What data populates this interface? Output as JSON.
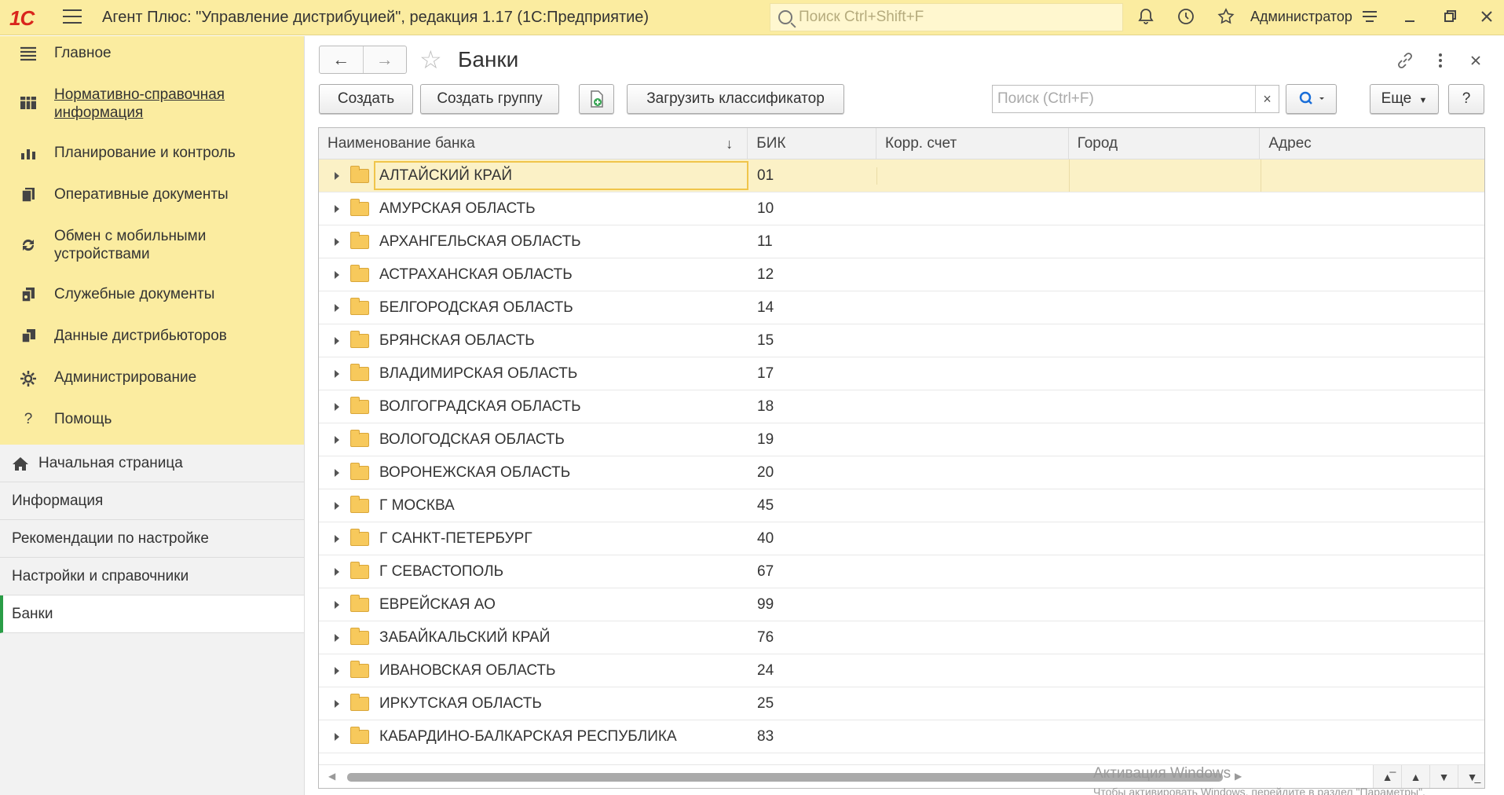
{
  "app": {
    "logo": "1С",
    "title": "Агент Плюс: \"Управление дистрибуцией\", редакция 1.17  (1С:Предприятие)",
    "search_placeholder": "Поиск Ctrl+Shift+F",
    "user": "Администратор"
  },
  "sidebar": {
    "sections": [
      {
        "label": "Главное",
        "icon": "menu-list-icon"
      },
      {
        "label": "Нормативно-справочная информация",
        "icon": "reference-table-icon"
      },
      {
        "label": "Планирование и контроль",
        "icon": "bar-chart-icon"
      },
      {
        "label": "Оперативные документы",
        "icon": "documents-icon"
      },
      {
        "label": "Обмен с мобильными устройствами",
        "icon": "sync-icon"
      },
      {
        "label": "Служебные документы",
        "icon": "service-docs-icon"
      },
      {
        "label": "Данные дистрибьюторов",
        "icon": "distributor-data-icon"
      },
      {
        "label": "Администрирование",
        "icon": "gear-icon"
      },
      {
        "label": "Помощь",
        "icon": "help-icon"
      }
    ],
    "open_pages": [
      {
        "label": "Начальная страница"
      },
      {
        "label": "Информация"
      },
      {
        "label": "Рекомендации по настройке"
      },
      {
        "label": "Настройки и справочники"
      },
      {
        "label": "Банки"
      }
    ]
  },
  "form": {
    "title": "Банки",
    "toolbar": {
      "create": "Создать",
      "create_group": "Создать группу",
      "load_classifier": "Загрузить классификатор",
      "search_placeholder": "Поиск (Ctrl+F)",
      "more": "Еще",
      "help": "?"
    },
    "columns": [
      "Наименование банка",
      "БИК",
      "Корр. счет",
      "Город",
      "Адрес"
    ],
    "rows": [
      {
        "name": "АЛТАЙСКИЙ КРАЙ",
        "bik": "01"
      },
      {
        "name": "АМУРСКАЯ ОБЛАСТЬ",
        "bik": "10"
      },
      {
        "name": "АРХАНГЕЛЬСКАЯ ОБЛАСТЬ",
        "bik": "11"
      },
      {
        "name": "АСТРАХАНСКАЯ ОБЛАСТЬ",
        "bik": "12"
      },
      {
        "name": "БЕЛГОРОДСКАЯ ОБЛАСТЬ",
        "bik": "14"
      },
      {
        "name": "БРЯНСКАЯ ОБЛАСТЬ",
        "bik": "15"
      },
      {
        "name": "ВЛАДИМИРСКАЯ ОБЛАСТЬ",
        "bik": "17"
      },
      {
        "name": "ВОЛГОГРАДСКАЯ ОБЛАСТЬ",
        "bik": "18"
      },
      {
        "name": "ВОЛОГОДСКАЯ ОБЛАСТЬ",
        "bik": "19"
      },
      {
        "name": "ВОРОНЕЖСКАЯ ОБЛАСТЬ",
        "bik": "20"
      },
      {
        "name": "Г МОСКВА",
        "bik": "45"
      },
      {
        "name": "Г САНКТ-ПЕТЕРБУРГ",
        "bik": "40"
      },
      {
        "name": "Г СЕВАСТОПОЛЬ",
        "bik": "67"
      },
      {
        "name": "ЕВРЕЙСКАЯ АО",
        "bik": "99"
      },
      {
        "name": "ЗАБАЙКАЛЬСКИЙ КРАЙ",
        "bik": "76"
      },
      {
        "name": "ИВАНОВСКАЯ ОБЛАСТЬ",
        "bik": "24"
      },
      {
        "name": "ИРКУТСКАЯ ОБЛАСТЬ",
        "bik": "25"
      },
      {
        "name": "КАБАРДИНО-БАЛКАРСКАЯ РЕСПУБЛИКА",
        "bik": "83"
      }
    ]
  },
  "watermark": {
    "line1": "Активация Windows",
    "line2": "Чтобы активировать Windows, перейдите в раздел \"Параметры\"."
  }
}
